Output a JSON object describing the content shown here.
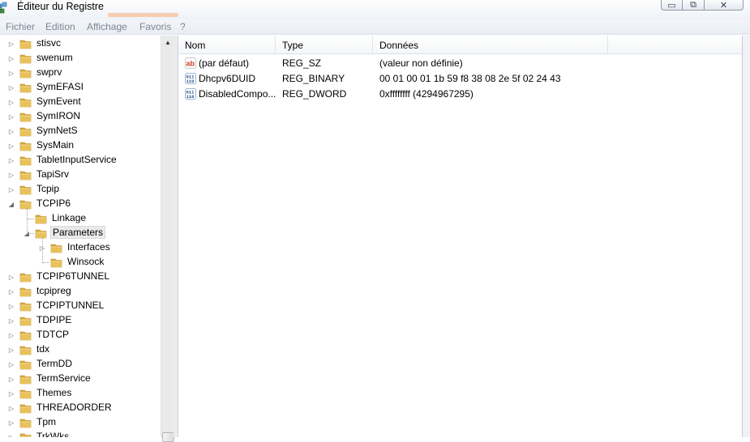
{
  "window": {
    "title": "Éditeur du Registre",
    "controls": {
      "minimize": "▭",
      "maximize": "⧉",
      "close": "✕"
    }
  },
  "menu": {
    "items": [
      "Fichier",
      "Edition",
      "Affichage",
      "Favoris"
    ],
    "help": "?"
  },
  "tree": {
    "items": [
      {
        "label": "stisvc",
        "state": "collapsed",
        "level": 0
      },
      {
        "label": "swenum",
        "state": "collapsed",
        "level": 0
      },
      {
        "label": "swprv",
        "state": "collapsed",
        "level": 0
      },
      {
        "label": "SymEFASI",
        "state": "collapsed",
        "level": 0
      },
      {
        "label": "SymEvent",
        "state": "collapsed",
        "level": 0
      },
      {
        "label": "SymIRON",
        "state": "collapsed",
        "level": 0
      },
      {
        "label": "SymNetS",
        "state": "collapsed",
        "level": 0
      },
      {
        "label": "SysMain",
        "state": "collapsed",
        "level": 0
      },
      {
        "label": "TabletInputService",
        "state": "collapsed",
        "level": 0
      },
      {
        "label": "TapiSrv",
        "state": "collapsed",
        "level": 0
      },
      {
        "label": "Tcpip",
        "state": "collapsed",
        "level": 0
      },
      {
        "label": "TCPIP6",
        "state": "expanded",
        "level": 0
      },
      {
        "label": "Linkage",
        "state": "leaf",
        "level": 1
      },
      {
        "label": "Parameters",
        "state": "expanded",
        "level": 1,
        "selected": true
      },
      {
        "label": "Interfaces",
        "state": "collapsed",
        "level": 2
      },
      {
        "label": "Winsock",
        "state": "leaf",
        "level": 2
      },
      {
        "label": "TCPIP6TUNNEL",
        "state": "collapsed",
        "level": 0
      },
      {
        "label": "tcpipreg",
        "state": "collapsed",
        "level": 0
      },
      {
        "label": "TCPIPTUNNEL",
        "state": "collapsed",
        "level": 0
      },
      {
        "label": "TDPIPE",
        "state": "collapsed",
        "level": 0
      },
      {
        "label": "TDTCP",
        "state": "collapsed",
        "level": 0
      },
      {
        "label": "tdx",
        "state": "collapsed",
        "level": 0
      },
      {
        "label": "TermDD",
        "state": "collapsed",
        "level": 0
      },
      {
        "label": "TermService",
        "state": "collapsed",
        "level": 0
      },
      {
        "label": "Themes",
        "state": "collapsed",
        "level": 0
      },
      {
        "label": "THREADORDER",
        "state": "collapsed",
        "level": 0
      },
      {
        "label": "Tpm",
        "state": "collapsed",
        "level": 0
      },
      {
        "label": "TrkWks",
        "state": "collapsed",
        "level": 0
      }
    ]
  },
  "list": {
    "columns": [
      "Nom",
      "Type",
      "Données"
    ],
    "rows": [
      {
        "icon": "string-value-icon",
        "name": "(par défaut)",
        "type": "REG_SZ",
        "data": "(valeur non définie)"
      },
      {
        "icon": "binary-value-icon",
        "name": "Dhcpv6DUID",
        "type": "REG_BINARY",
        "data": "00 01 00 01 1b 59 f8 38 08 2e 5f 02 24 43"
      },
      {
        "icon": "binary-value-icon",
        "name": "DisabledCompo...",
        "type": "REG_DWORD",
        "data": "0xffffffff (4294967295)"
      }
    ]
  },
  "colors": {
    "folder": "#e8c15a",
    "menu_text": "#7d8793"
  }
}
